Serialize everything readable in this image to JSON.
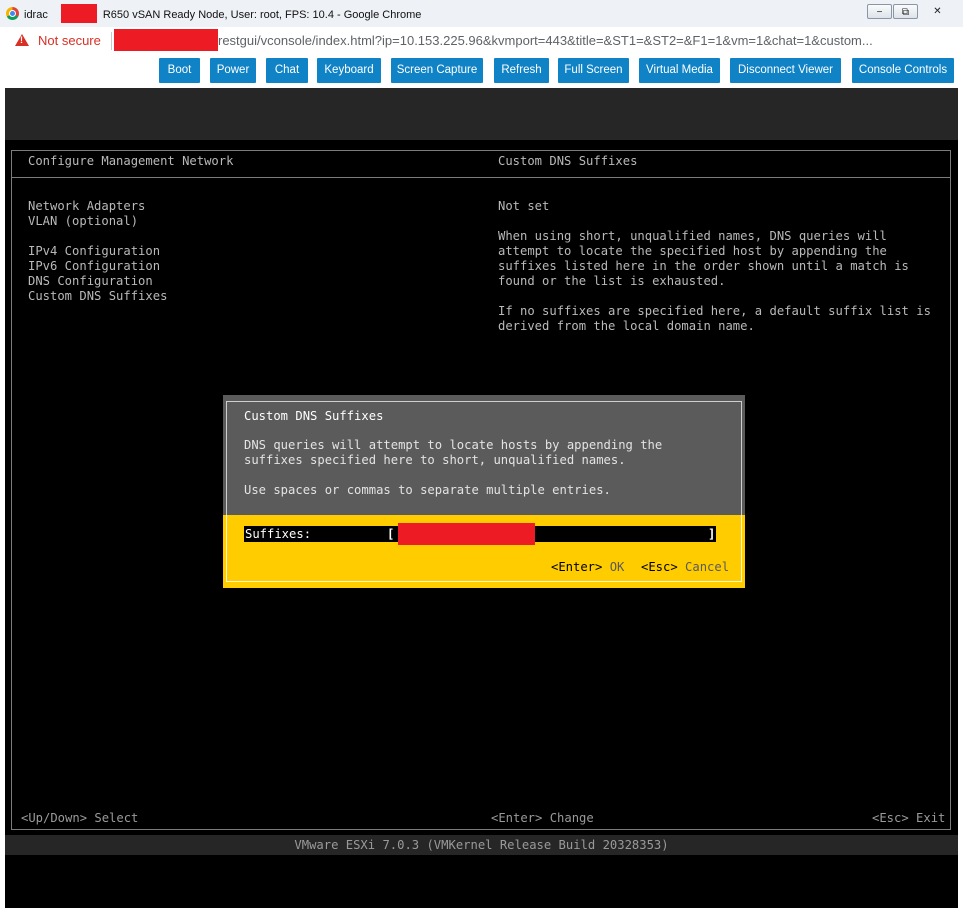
{
  "window": {
    "title_prefix": "idrac",
    "title_suffix": "R650 vSAN Ready Node, User: root, FPS: 10.4 - Google Chrome",
    "minimize": "−",
    "restore": "⧉",
    "close": "✕"
  },
  "address_bar": {
    "security_label": "Not secure",
    "warning_mark": "!",
    "url": "restgui/vconsole/index.html?ip=10.153.225.96&kvmport=443&title=&ST1=&ST2=&F1=1&vm=1&chat=1&custom..."
  },
  "toolbar": {
    "buttons": [
      "Boot",
      "Power",
      "Chat",
      "Keyboard",
      "Screen Capture",
      "Refresh",
      "Full Screen",
      "Virtual Media",
      "Disconnect Viewer",
      "Console Controls"
    ]
  },
  "console": {
    "left_header": "Configure Management Network",
    "right_header": "Custom DNS Suffixes",
    "menu": [
      "Network Adapters",
      "VLAN (optional)",
      "IPv4 Configuration",
      "IPv6 Configuration",
      "DNS Configuration",
      "Custom DNS Suffixes"
    ],
    "status": "Not set",
    "description_1": "When using short, unqualified names, DNS queries will\nattempt to locate the specified host by appending the\nsuffixes listed here in the order shown until a match is\nfound or the list is exhausted.",
    "description_2": "If no suffixes are specified here, a default suffix list is\nderived from the local domain name.",
    "footer_left": "<Up/Down> Select",
    "footer_center": "<Enter> Change",
    "footer_right": "<Esc> Exit",
    "build": "VMware ESXi 7.0.3 (VMKernel Release Build 20328353)"
  },
  "dialog": {
    "title": "Custom DNS Suffixes",
    "text_1": "DNS queries will attempt to locate hosts by appending the\nsuffixes specified here to short, unqualified names.",
    "text_2": "Use spaces or commas to separate multiple entries.",
    "field_label": "Suffixes:",
    "bracket_open": "[",
    "bracket_close": "]",
    "field_value": "",
    "ok_key": "<Enter>",
    "ok_label": "OK",
    "cancel_key": "<Esc>",
    "cancel_label": "Cancel"
  }
}
